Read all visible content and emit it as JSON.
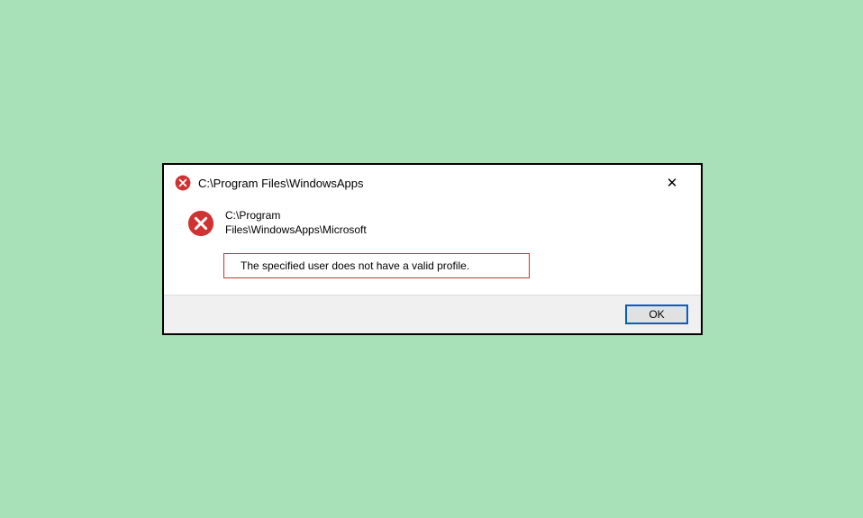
{
  "dialog": {
    "title": "C:\\Program Files\\WindowsApps",
    "body_path": "C:\\Program Files\\WindowsApps\\Microsoft",
    "error_message": "The specified user does not have a valid profile.",
    "ok_label": "OK",
    "close_glyph": "✕"
  },
  "colors": {
    "error_red": "#d03232",
    "highlight_border": "#da2a2a",
    "ok_border": "#0a5ec2",
    "page_bg": "#a8e0b8"
  }
}
